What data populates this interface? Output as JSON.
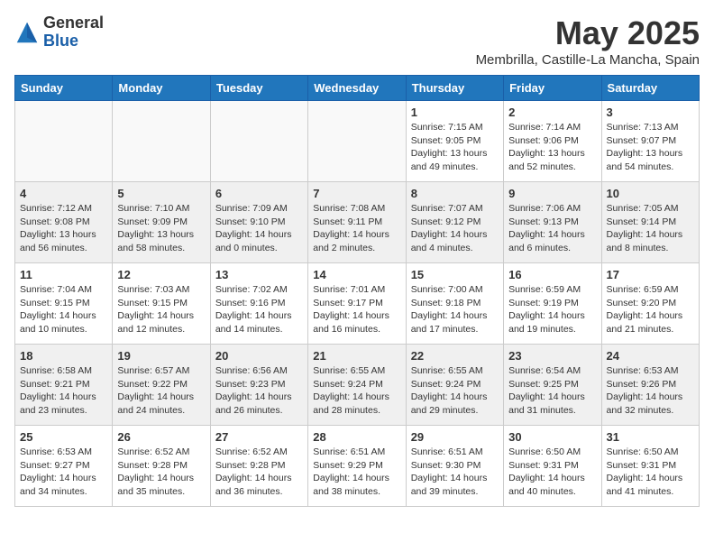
{
  "logo": {
    "general": "General",
    "blue": "Blue"
  },
  "title": {
    "month": "May 2025",
    "location": "Membrilla, Castille-La Mancha, Spain"
  },
  "days_of_week": [
    "Sunday",
    "Monday",
    "Tuesday",
    "Wednesday",
    "Thursday",
    "Friday",
    "Saturday"
  ],
  "weeks": [
    [
      {
        "day": "",
        "info": ""
      },
      {
        "day": "",
        "info": ""
      },
      {
        "day": "",
        "info": ""
      },
      {
        "day": "",
        "info": ""
      },
      {
        "day": "1",
        "info": "Sunrise: 7:15 AM\nSunset: 9:05 PM\nDaylight: 13 hours\nand 49 minutes."
      },
      {
        "day": "2",
        "info": "Sunrise: 7:14 AM\nSunset: 9:06 PM\nDaylight: 13 hours\nand 52 minutes."
      },
      {
        "day": "3",
        "info": "Sunrise: 7:13 AM\nSunset: 9:07 PM\nDaylight: 13 hours\nand 54 minutes."
      }
    ],
    [
      {
        "day": "4",
        "info": "Sunrise: 7:12 AM\nSunset: 9:08 PM\nDaylight: 13 hours\nand 56 minutes."
      },
      {
        "day": "5",
        "info": "Sunrise: 7:10 AM\nSunset: 9:09 PM\nDaylight: 13 hours\nand 58 minutes."
      },
      {
        "day": "6",
        "info": "Sunrise: 7:09 AM\nSunset: 9:10 PM\nDaylight: 14 hours\nand 0 minutes."
      },
      {
        "day": "7",
        "info": "Sunrise: 7:08 AM\nSunset: 9:11 PM\nDaylight: 14 hours\nand 2 minutes."
      },
      {
        "day": "8",
        "info": "Sunrise: 7:07 AM\nSunset: 9:12 PM\nDaylight: 14 hours\nand 4 minutes."
      },
      {
        "day": "9",
        "info": "Sunrise: 7:06 AM\nSunset: 9:13 PM\nDaylight: 14 hours\nand 6 minutes."
      },
      {
        "day": "10",
        "info": "Sunrise: 7:05 AM\nSunset: 9:14 PM\nDaylight: 14 hours\nand 8 minutes."
      }
    ],
    [
      {
        "day": "11",
        "info": "Sunrise: 7:04 AM\nSunset: 9:15 PM\nDaylight: 14 hours\nand 10 minutes."
      },
      {
        "day": "12",
        "info": "Sunrise: 7:03 AM\nSunset: 9:15 PM\nDaylight: 14 hours\nand 12 minutes."
      },
      {
        "day": "13",
        "info": "Sunrise: 7:02 AM\nSunset: 9:16 PM\nDaylight: 14 hours\nand 14 minutes."
      },
      {
        "day": "14",
        "info": "Sunrise: 7:01 AM\nSunset: 9:17 PM\nDaylight: 14 hours\nand 16 minutes."
      },
      {
        "day": "15",
        "info": "Sunrise: 7:00 AM\nSunset: 9:18 PM\nDaylight: 14 hours\nand 17 minutes."
      },
      {
        "day": "16",
        "info": "Sunrise: 6:59 AM\nSunset: 9:19 PM\nDaylight: 14 hours\nand 19 minutes."
      },
      {
        "day": "17",
        "info": "Sunrise: 6:59 AM\nSunset: 9:20 PM\nDaylight: 14 hours\nand 21 minutes."
      }
    ],
    [
      {
        "day": "18",
        "info": "Sunrise: 6:58 AM\nSunset: 9:21 PM\nDaylight: 14 hours\nand 23 minutes."
      },
      {
        "day": "19",
        "info": "Sunrise: 6:57 AM\nSunset: 9:22 PM\nDaylight: 14 hours\nand 24 minutes."
      },
      {
        "day": "20",
        "info": "Sunrise: 6:56 AM\nSunset: 9:23 PM\nDaylight: 14 hours\nand 26 minutes."
      },
      {
        "day": "21",
        "info": "Sunrise: 6:55 AM\nSunset: 9:24 PM\nDaylight: 14 hours\nand 28 minutes."
      },
      {
        "day": "22",
        "info": "Sunrise: 6:55 AM\nSunset: 9:24 PM\nDaylight: 14 hours\nand 29 minutes."
      },
      {
        "day": "23",
        "info": "Sunrise: 6:54 AM\nSunset: 9:25 PM\nDaylight: 14 hours\nand 31 minutes."
      },
      {
        "day": "24",
        "info": "Sunrise: 6:53 AM\nSunset: 9:26 PM\nDaylight: 14 hours\nand 32 minutes."
      }
    ],
    [
      {
        "day": "25",
        "info": "Sunrise: 6:53 AM\nSunset: 9:27 PM\nDaylight: 14 hours\nand 34 minutes."
      },
      {
        "day": "26",
        "info": "Sunrise: 6:52 AM\nSunset: 9:28 PM\nDaylight: 14 hours\nand 35 minutes."
      },
      {
        "day": "27",
        "info": "Sunrise: 6:52 AM\nSunset: 9:28 PM\nDaylight: 14 hours\nand 36 minutes."
      },
      {
        "day": "28",
        "info": "Sunrise: 6:51 AM\nSunset: 9:29 PM\nDaylight: 14 hours\nand 38 minutes."
      },
      {
        "day": "29",
        "info": "Sunrise: 6:51 AM\nSunset: 9:30 PM\nDaylight: 14 hours\nand 39 minutes."
      },
      {
        "day": "30",
        "info": "Sunrise: 6:50 AM\nSunset: 9:31 PM\nDaylight: 14 hours\nand 40 minutes."
      },
      {
        "day": "31",
        "info": "Sunrise: 6:50 AM\nSunset: 9:31 PM\nDaylight: 14 hours\nand 41 minutes."
      }
    ]
  ]
}
